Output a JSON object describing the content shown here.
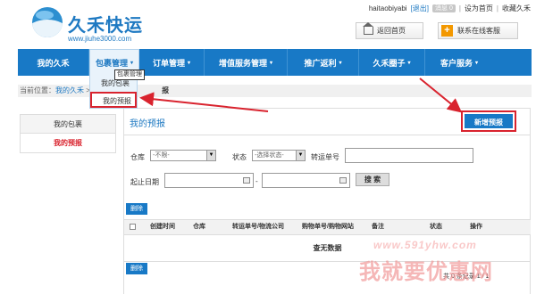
{
  "brand": {
    "name": "久禾快运",
    "url": "www.jiuhe3000.com"
  },
  "toplinks": {
    "username": "haitaobiyabi",
    "logout": "[退出]",
    "messages": "消息 0",
    "sep": "|",
    "home_link": "设为首页",
    "fav_link": "收藏久禾"
  },
  "header_buttons": {
    "home": "返回首页",
    "service": "联系在线客服"
  },
  "nav": {
    "items": [
      {
        "label": "我的久禾",
        "caret": ""
      },
      {
        "label": "包裹管理",
        "caret": "▾"
      },
      {
        "label": "订单管理",
        "caret": "▾"
      },
      {
        "label": "增值服务管理",
        "caret": "▾"
      },
      {
        "label": "推广返利",
        "caret": "▾"
      },
      {
        "label": "久禾圈子",
        "caret": "▾"
      },
      {
        "label": "客户服务",
        "caret": "▾"
      }
    ],
    "tooltip": "包裹管理",
    "dropdown": [
      "我的包裹",
      "我的预报"
    ]
  },
  "breadcrumb": {
    "prefix": "当前位置：",
    "link": "我的久禾",
    "sep": " > ",
    "current": "报"
  },
  "sidebar": {
    "items": [
      "我的包裹",
      "我的预报"
    ]
  },
  "main": {
    "title": "我的预报",
    "new_button": "新增预报",
    "filters": {
      "warehouse_label": "仓库",
      "warehouse_value": "-不限-",
      "status_label": "状态",
      "status_value": "-选择状态-",
      "tracking_label": "转运单号",
      "date_label": "起止日期",
      "date_sep": "-",
      "search_button": "搜 索"
    },
    "delete_button": "删除",
    "table": {
      "headers": [
        "创建时间",
        "仓库",
        "转运单号/物流公司",
        "购物单号/购物网站",
        "备注",
        "状态",
        "操作"
      ],
      "empty": "查无数据"
    },
    "pager": "共 0 条记录 1 / 1"
  },
  "watermark": {
    "url": "www.591yhw.com",
    "text": "我就要优惠网"
  },
  "colors": {
    "nav": "#1879c6",
    "accent_red": "#d9232e",
    "link_blue": "#1e79c2",
    "service_orange": "#f39800"
  }
}
